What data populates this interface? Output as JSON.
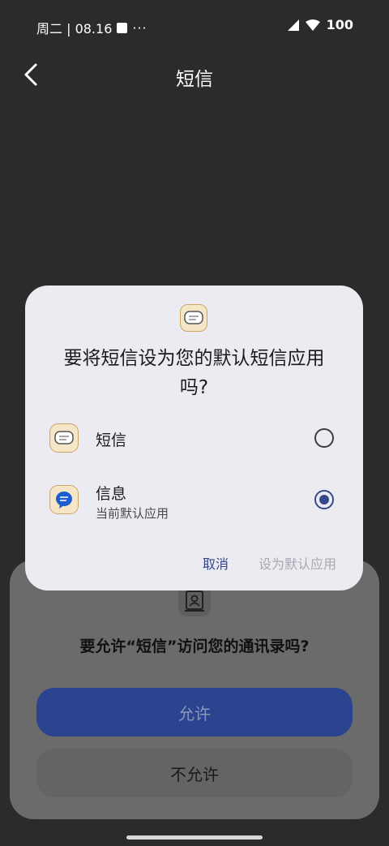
{
  "status_bar": {
    "datetime": "周二 | 08.16",
    "more": "···",
    "battery": "100"
  },
  "app_bar": {
    "title": "短信"
  },
  "permission_sheet": {
    "question": "要允许“短信”访问您的通讯录吗?",
    "allow_label": "允许",
    "deny_label": "不允许"
  },
  "dialog": {
    "title": "要将短信设为您的默认短信应用吗?",
    "options": [
      {
        "label": "短信",
        "sublabel": "",
        "selected": false,
        "icon": "sms-app-icon"
      },
      {
        "label": "信息",
        "sublabel": "当前默认应用",
        "selected": true,
        "icon": "messages-app-icon"
      }
    ],
    "cancel_label": "取消",
    "set_default_label": "设为默认应用"
  },
  "colors": {
    "accent": "#34478a",
    "dialog_bg": "#ecebf2",
    "background": "#2b2b2b"
  }
}
